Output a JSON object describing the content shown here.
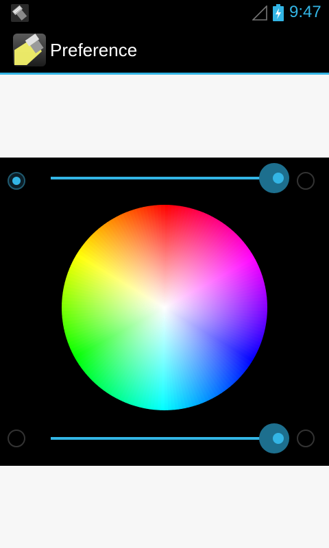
{
  "status_bar": {
    "time": "9:47",
    "app_icon": "flashlight-notification-icon",
    "signal_icon": "signal-strength-icon",
    "battery_icon": "battery-charging-icon",
    "accent_color": "#33b5e5"
  },
  "action_bar": {
    "app_icon": "flashlight-app-icon",
    "title": "Preference"
  },
  "color_picker": {
    "top_slider": {
      "value": 1.0,
      "left_radio_selected": true,
      "right_radio_selected": false
    },
    "bottom_slider": {
      "value": 1.0,
      "left_radio_selected": false,
      "right_radio_selected": false
    },
    "wheel": "color-wheel"
  },
  "colors": {
    "accent": "#33b5e5",
    "panel_background": "#000000",
    "light_background": "#f7f7f7"
  }
}
